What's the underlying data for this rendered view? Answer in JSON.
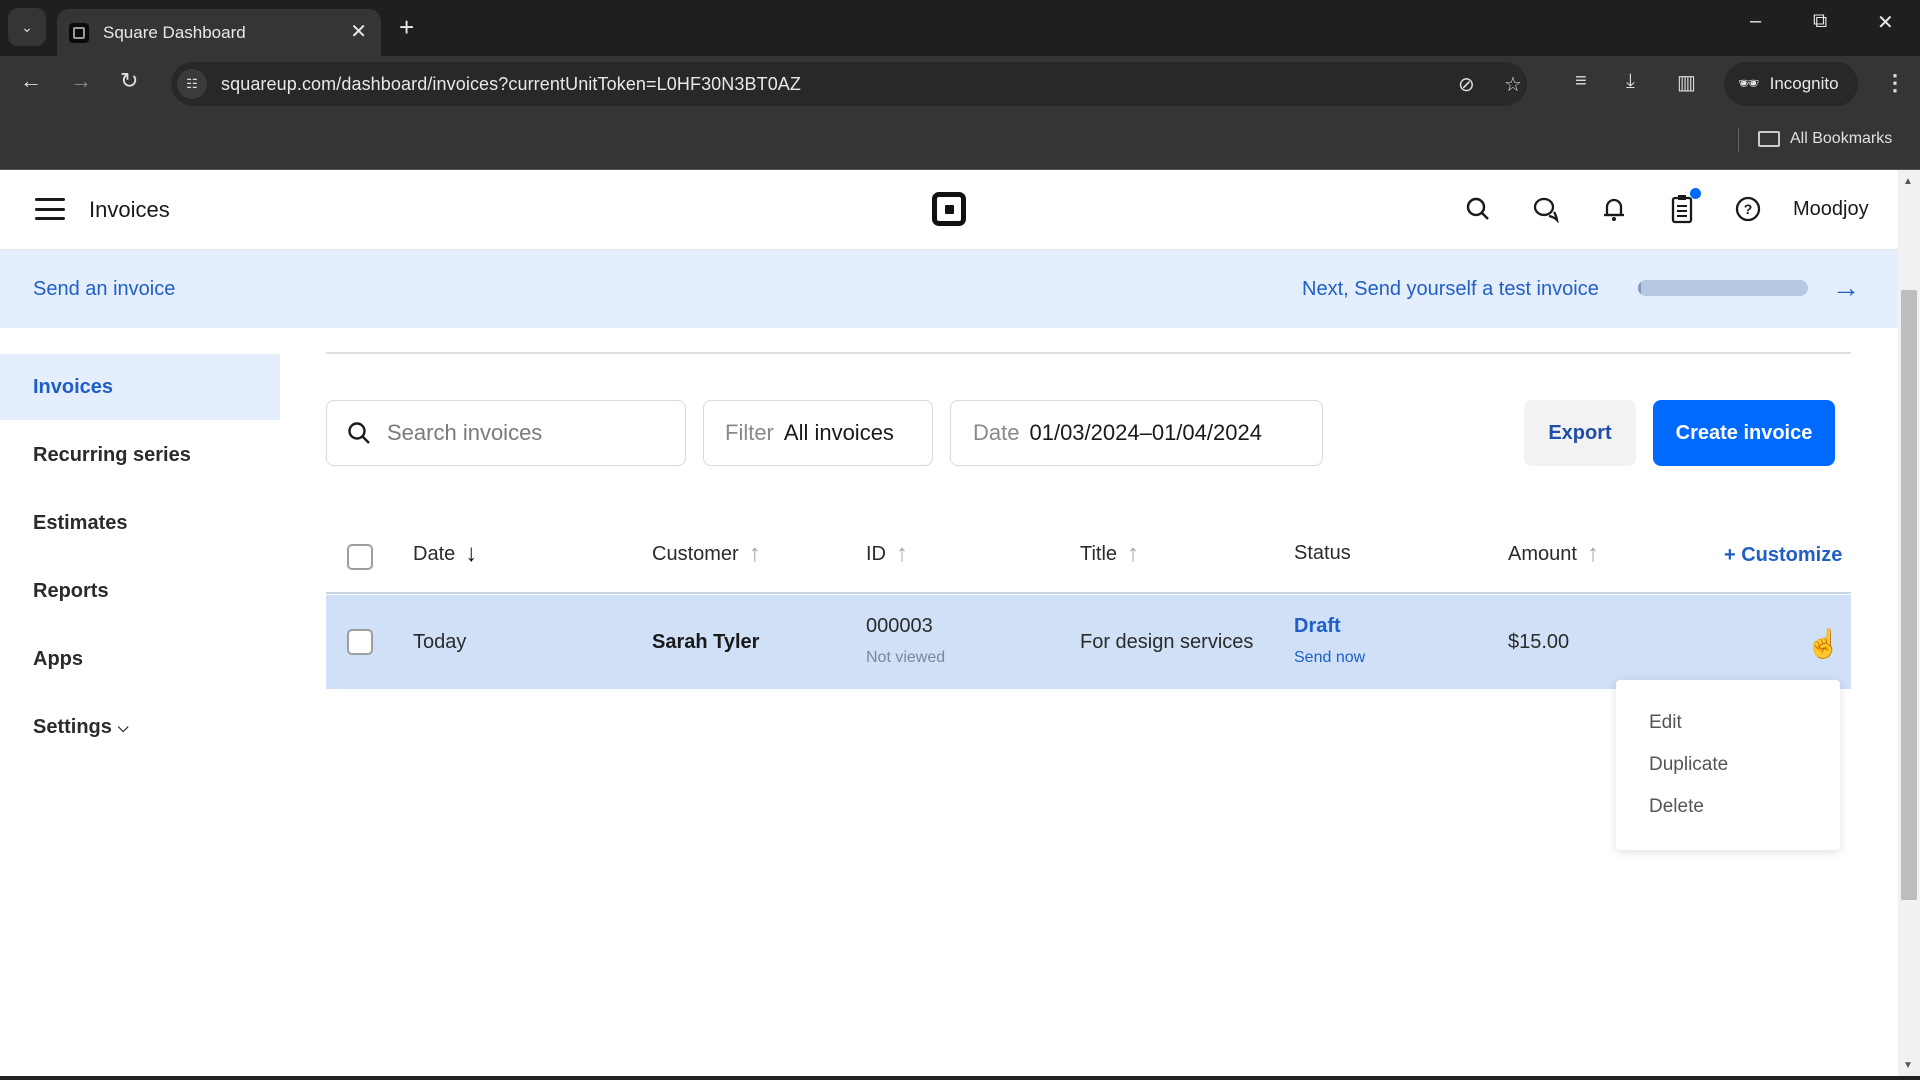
{
  "browser": {
    "tab_title": "Square Dashboard",
    "url": "squareup.com/dashboard/invoices?currentUnitToken=L0HF30N3BT0AZ",
    "incognito_label": "Incognito",
    "bookmarks_label": "All Bookmarks",
    "icons": {
      "tab_search": "chevron-down-icon",
      "close_tab": "close-icon",
      "new_tab": "plus-icon",
      "back": "arrow-left-icon",
      "forward": "arrow-right-icon",
      "reload": "reload-icon",
      "site_info": "tune-icon",
      "eye_off": "eye-off-icon",
      "bookmark": "star-icon",
      "media": "playlist-icon",
      "download": "download-icon",
      "side_panel": "side-panel-icon",
      "menu": "kebab-icon"
    }
  },
  "header": {
    "title": "Invoices",
    "user_name": "Moodjoy",
    "icons": [
      "search-icon",
      "messages-icon",
      "bell-icon",
      "clipboard-icon",
      "help-icon"
    ],
    "accent_color": "#006aff"
  },
  "banner": {
    "left_link": "Send an invoice",
    "next_text": "Next, Send yourself a test invoice",
    "progress_percent": 2
  },
  "sidebar": {
    "items": [
      {
        "label": "Invoices",
        "active": true
      },
      {
        "label": "Recurring series",
        "active": false
      },
      {
        "label": "Estimates",
        "active": false
      },
      {
        "label": "Reports",
        "active": false
      },
      {
        "label": "Apps",
        "active": false
      },
      {
        "label": "Settings",
        "active": false
      }
    ]
  },
  "toolbar": {
    "search_placeholder": "Search invoices",
    "filter_label": "Filter",
    "filter_value": "All invoices",
    "date_label": "Date",
    "date_value": "01/03/2024–01/04/2024",
    "export_label": "Export",
    "create_label": "Create invoice"
  },
  "table": {
    "columns": [
      "Date",
      "Customer",
      "ID",
      "Title",
      "Status",
      "Amount"
    ],
    "customize_label": "+ Customize",
    "rows": [
      {
        "date": "Today",
        "customer": "Sarah Tyler",
        "id": "000003",
        "view_status": "Not viewed",
        "title": "For design services",
        "status": "Draft",
        "action": "Send now",
        "amount": "$15.00"
      }
    ]
  },
  "context_menu": {
    "items": [
      "Edit",
      "Duplicate",
      "Delete"
    ]
  },
  "colors": {
    "primary_blue": "#006aff",
    "link_blue": "#1f5fc7",
    "highlight_row": "#cfe0f7",
    "banner_bg": "#e4eefc"
  }
}
